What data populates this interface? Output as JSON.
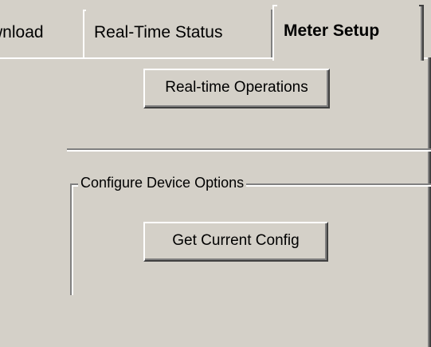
{
  "tabs": [
    {
      "label": "wnload",
      "active": false
    },
    {
      "label": "Real-Time Status",
      "active": false
    },
    {
      "label": "Meter Setup",
      "active": true
    }
  ],
  "panel": {
    "realtime_button_label": "Real-time Operations",
    "group": {
      "title": "Configure Device Options",
      "get_config_button_label": "Get Current Config"
    }
  },
  "colors": {
    "face": "#d4d0c8",
    "highlight": "#ffffff",
    "shadow": "#808080",
    "dark_shadow": "#404040"
  }
}
